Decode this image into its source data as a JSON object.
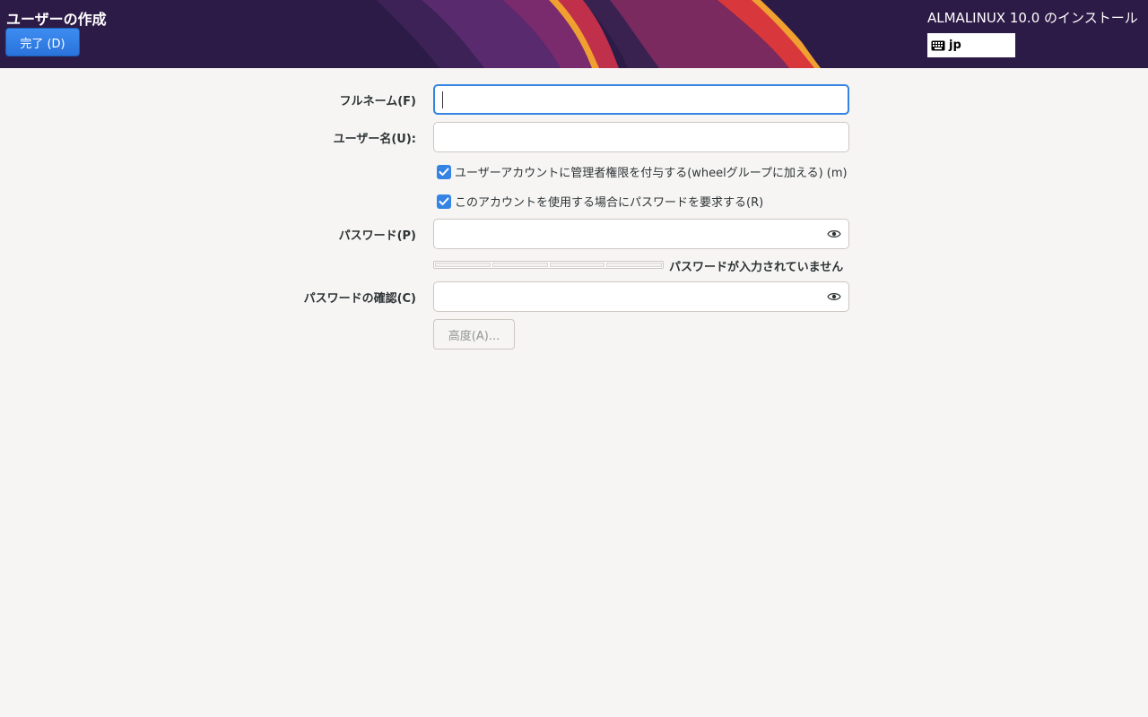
{
  "header": {
    "title": "ユーザーの作成",
    "done_label": "完了 (D)",
    "product": "ALMALINUX 10.0 のインストール",
    "keyboard_layout": "jp",
    "keyboard_icon": "keyboard-icon"
  },
  "form": {
    "fullname_label": "フルネーム(F)",
    "fullname_value": "",
    "username_label": "ユーザー名(U):",
    "username_value": "",
    "admin_checkbox_label": "ユーザーアカウントに管理者権限を付与する(wheelグループに加える) (m)",
    "admin_checked": true,
    "require_password_label": "このアカウントを使用する場合にパスワードを要求する(R)",
    "require_password_checked": true,
    "password_label": "パスワード(P)",
    "password_value": "",
    "strength_text": "パスワードが入力されていません",
    "strength_level": 0,
    "confirm_label": "パスワードの確認(C)",
    "confirm_value": "",
    "advanced_label": "高度(A)...",
    "reveal_icon": "eye-icon"
  },
  "colors": {
    "accent": "#3584e4",
    "header_bg": "#2d1b47",
    "page_bg": "#f6f5f4"
  }
}
